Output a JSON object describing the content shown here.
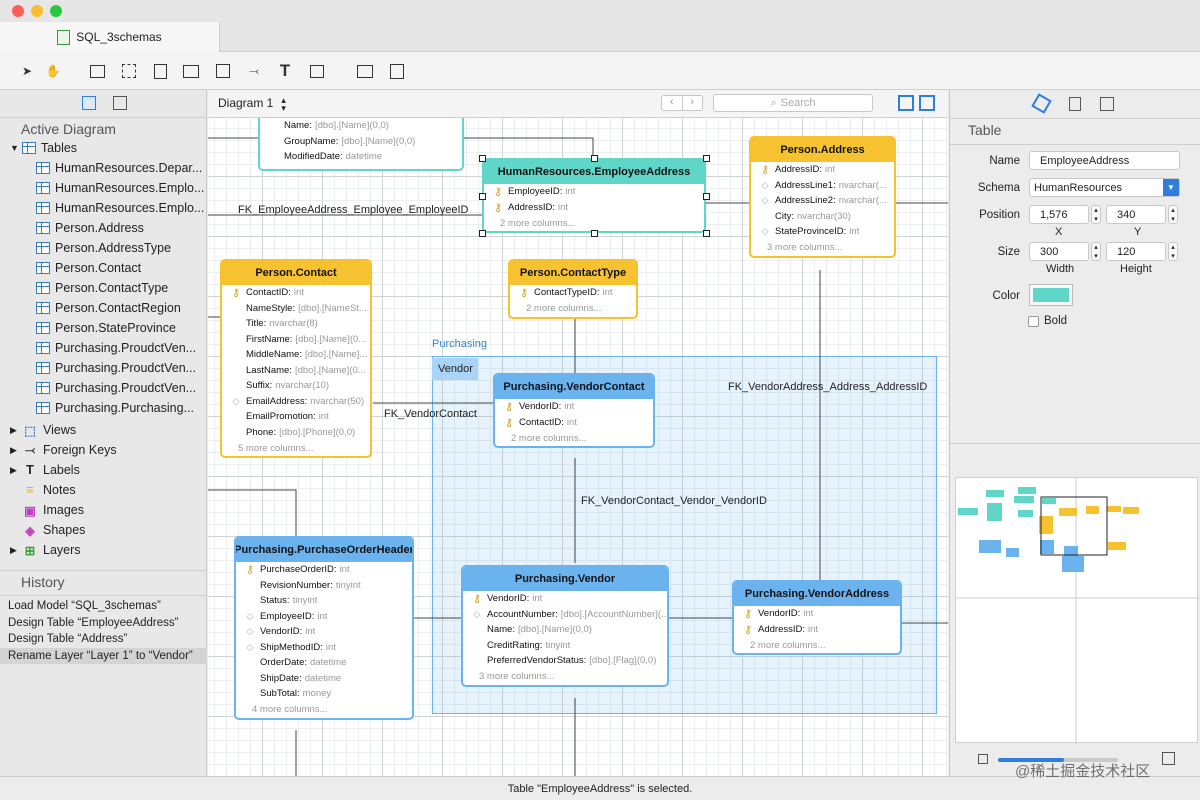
{
  "window": {
    "tab_title": "SQL_3schemas"
  },
  "sidebar": {
    "heading": "Active Diagram",
    "tables_label": "Tables",
    "tables": [
      "HumanResources.Depar...",
      "HumanResources.Emplo...",
      "HumanResources.Emplo...",
      "Person.Address",
      "Person.AddressType",
      "Person.Contact",
      "Person.ContactType",
      "Person.ContactRegion",
      "Person.StateProvince",
      "Purchasing.ProudctVen...",
      "Purchasing.ProudctVen...",
      "Purchasing.ProudctVen...",
      "Purchasing.Purchasing..."
    ],
    "sections": [
      "Views",
      "Foreign Keys",
      "Labels",
      "Notes",
      "Images",
      "Shapes",
      "Layers"
    ],
    "history_heading": "History",
    "history": [
      "Load Model “SQL_3schemas”",
      "Design Table “EmployeeAddress”",
      "Design Table “Address”",
      "Rename Layer “Layer 1” to “Vendor”"
    ]
  },
  "canvasbar": {
    "diagram": "Diagram 1",
    "search_placeholder": "Search"
  },
  "canvas": {
    "layer_label": "Purchasing",
    "layer_tag": "Vendor",
    "fk_labels": [
      "FK_EmployeeAddress_Employee_EmployeeID",
      "FK_VendorContact",
      "FK_VendorAddress_Address_AddressID",
      "FK_VendorContact_Vendor_VendorID"
    ],
    "tables": {
      "top": {
        "rows": [
          {
            "n": "Name:",
            "t": "[dbo].[Name](0,0)"
          },
          {
            "n": "GroupName:",
            "t": "[dbo].[Name](0,0)"
          },
          {
            "n": "ModifiedDate:",
            "t": "datetime"
          }
        ]
      },
      "empaddr": {
        "title": "HumanResources.EmployeeAddress",
        "rows": [
          {
            "n": "EmployeeID:",
            "t": "int"
          },
          {
            "n": "AddressID:",
            "t": "int"
          }
        ],
        "more": "2 more columns..."
      },
      "address": {
        "title": "Person.Address",
        "rows": [
          {
            "n": "AddressID:",
            "t": "int"
          },
          {
            "n": "AddressLine1:",
            "t": "nvarchar(..."
          },
          {
            "n": "AddressLine2:",
            "t": "nvarchar(..."
          },
          {
            "n": "City:",
            "t": "nvarchar(30)"
          },
          {
            "n": "StateProvinceID:",
            "t": "int"
          }
        ],
        "more": "3 more columns..."
      },
      "contact": {
        "title": "Person.Contact",
        "rows": [
          {
            "n": "ContactID:",
            "t": "int"
          },
          {
            "n": "NameStyle:",
            "t": "[dbo].[NameSt..."
          },
          {
            "n": "Title:",
            "t": "nvarchar(8)"
          },
          {
            "n": "FirstName:",
            "t": "[dbo].[Name](0..."
          },
          {
            "n": "MiddleName:",
            "t": "[dbo].[Name]..."
          },
          {
            "n": "LastName:",
            "t": "[dbo].[Name](0..."
          },
          {
            "n": "Suffix:",
            "t": "nvarchar(10)"
          },
          {
            "n": "EmailAddress:",
            "t": "nvarchar(50)"
          },
          {
            "n": "EmailPromotion:",
            "t": "int"
          },
          {
            "n": "Phone:",
            "t": "[dbo].[Phone](0,0)"
          }
        ],
        "more": "5 more columns..."
      },
      "contacttype": {
        "title": "Person.ContactType",
        "rows": [
          {
            "n": "ContactTypeID:",
            "t": "int"
          }
        ],
        "more": "2 more columns..."
      },
      "vendorcontact": {
        "title": "Purchasing.VendorContact",
        "rows": [
          {
            "n": "VendorID:",
            "t": "int"
          },
          {
            "n": "ContactID:",
            "t": "int"
          }
        ],
        "more": "2 more columns..."
      },
      "poh": {
        "title": "Purchasing.PurchaseOrderHeader",
        "rows": [
          {
            "n": "PurchaseOrderID:",
            "t": "int"
          },
          {
            "n": "RevisionNumber:",
            "t": "tinyint"
          },
          {
            "n": "Status:",
            "t": "tinyint"
          },
          {
            "n": "EmployeeID:",
            "t": "int"
          },
          {
            "n": "VendorID:",
            "t": "int"
          },
          {
            "n": "ShipMethodID:",
            "t": "int"
          },
          {
            "n": "OrderDate:",
            "t": "datetime"
          },
          {
            "n": "ShipDate:",
            "t": "datetime"
          },
          {
            "n": "SubTotal:",
            "t": "money"
          }
        ],
        "more": "4 more columns..."
      },
      "vendor": {
        "title": "Purchasing.Vendor",
        "rows": [
          {
            "n": "VendorID:",
            "t": "int"
          },
          {
            "n": "AccountNumber:",
            "t": "[dbo].[AccountNumber](..."
          },
          {
            "n": "Name:",
            "t": "[dbo].[Name](0,0)"
          },
          {
            "n": "CreditRating:",
            "t": "tinyint"
          },
          {
            "n": "PreferredVendorStatus:",
            "t": "[dbo].[Flag](0,0)"
          }
        ],
        "more": "3 more columns..."
      },
      "vendoraddr": {
        "title": "Purchasing.VendorAddress",
        "rows": [
          {
            "n": "VendorID:",
            "t": "int"
          },
          {
            "n": "AddressID:",
            "t": "int"
          }
        ],
        "more": "2 more columns..."
      }
    }
  },
  "inspector": {
    "heading": "Table",
    "name_label": "Name",
    "name_value": "EmployeeAddress",
    "schema_label": "Schema",
    "schema_value": "HumanResources",
    "position_label": "Position",
    "x_value": "1,576",
    "y_value": "340",
    "x_label": "X",
    "y_label": "Y",
    "size_label": "Size",
    "width_value": "300",
    "height_value": "120",
    "width_label": "Width",
    "height_label": "Height",
    "color_label": "Color",
    "color_value": "#5fd6c8",
    "bold_label": "Bold"
  },
  "status": "Table \"EmployeeAddress\" is selected.",
  "watermark": "@稀土掘金技术社区"
}
